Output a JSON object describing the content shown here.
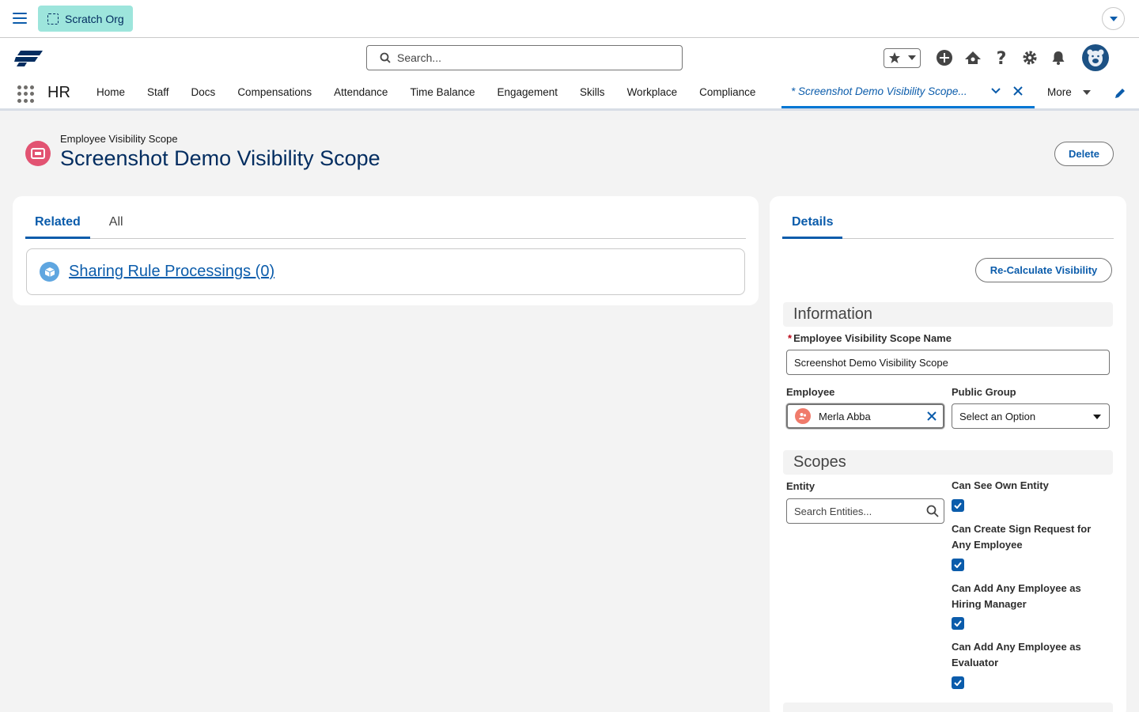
{
  "utility": {
    "org_badge": "Scratch Org"
  },
  "header": {
    "search_placeholder": "Search..."
  },
  "nav": {
    "app_name": "HR",
    "items": [
      "Home",
      "Staff",
      "Docs",
      "Compensations",
      "Attendance",
      "Time Balance",
      "Engagement",
      "Skills",
      "Workplace",
      "Compliance"
    ],
    "active_tab": "* Screenshot Demo Visibility Scope...",
    "more": "More"
  },
  "record": {
    "type": "Employee Visibility Scope",
    "title": "Screenshot Demo Visibility Scope",
    "delete_label": "Delete"
  },
  "related": {
    "tabs": [
      "Related",
      "All"
    ],
    "list_link": "Sharing Rule Processings (0)"
  },
  "details": {
    "tab": "Details",
    "recalc_label": "Re-Calculate Visibility",
    "info_section": "Information",
    "name_label": "Employee Visibility Scope Name",
    "name_value": "Screenshot Demo Visibility Scope",
    "employee_label": "Employee",
    "employee_value": "Merla Abba",
    "group_label": "Public Group",
    "group_value": "Select an Option",
    "scopes_section": "Scopes",
    "entity_label": "Entity",
    "entity_placeholder": "Search Entities...",
    "checkboxes": [
      {
        "label": "Can See Own Entity",
        "checked": true
      },
      {
        "label": "Can Create Sign Request for Any Employee",
        "checked": true
      },
      {
        "label": "Can Add Any Employee as Hiring Manager",
        "checked": true
      },
      {
        "label": "Can Add Any Employee as Evaluator",
        "checked": true
      }
    ]
  },
  "colors": {
    "brand": "#0b5cab",
    "active_tab": "#0176d3",
    "record_icon": "#e25372",
    "org_badge": "#9de5dc"
  }
}
